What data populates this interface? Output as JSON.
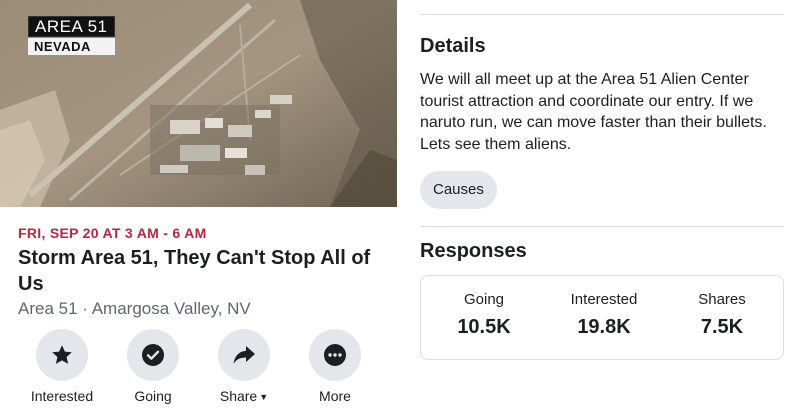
{
  "cover": {
    "overlay_line1": "AREA 51",
    "overlay_line2": "NEVADA"
  },
  "event": {
    "date": "FRI, SEP 20 AT 3 AM - 6 AM",
    "title": "Storm Area 51, They Can't Stop All of Us",
    "location": "Area 51 · Amargosa Valley, NV"
  },
  "actions": [
    {
      "label": "Interested",
      "icon": "star-icon"
    },
    {
      "label": "Going",
      "icon": "check-circle-icon"
    },
    {
      "label": "Share",
      "icon": "share-arrow-icon"
    },
    {
      "label": "More",
      "icon": "more-dots-icon"
    }
  ],
  "details": {
    "heading": "Details",
    "text": "We will all meet up at the Area 51 Alien Center tourist attraction and coordinate our entry. If we naruto run, we can move faster than their bullets. Lets see them aliens.",
    "chip": "Causes"
  },
  "responses": {
    "heading": "Responses",
    "stats": [
      {
        "label": "Going",
        "value": "10.5K"
      },
      {
        "label": "Interested",
        "value": "19.8K"
      },
      {
        "label": "Shares",
        "value": "7.5K"
      }
    ]
  },
  "colors": {
    "date_red": "#c0233b",
    "button_grey": "#e4e6eb",
    "divider": "#dadde1"
  }
}
